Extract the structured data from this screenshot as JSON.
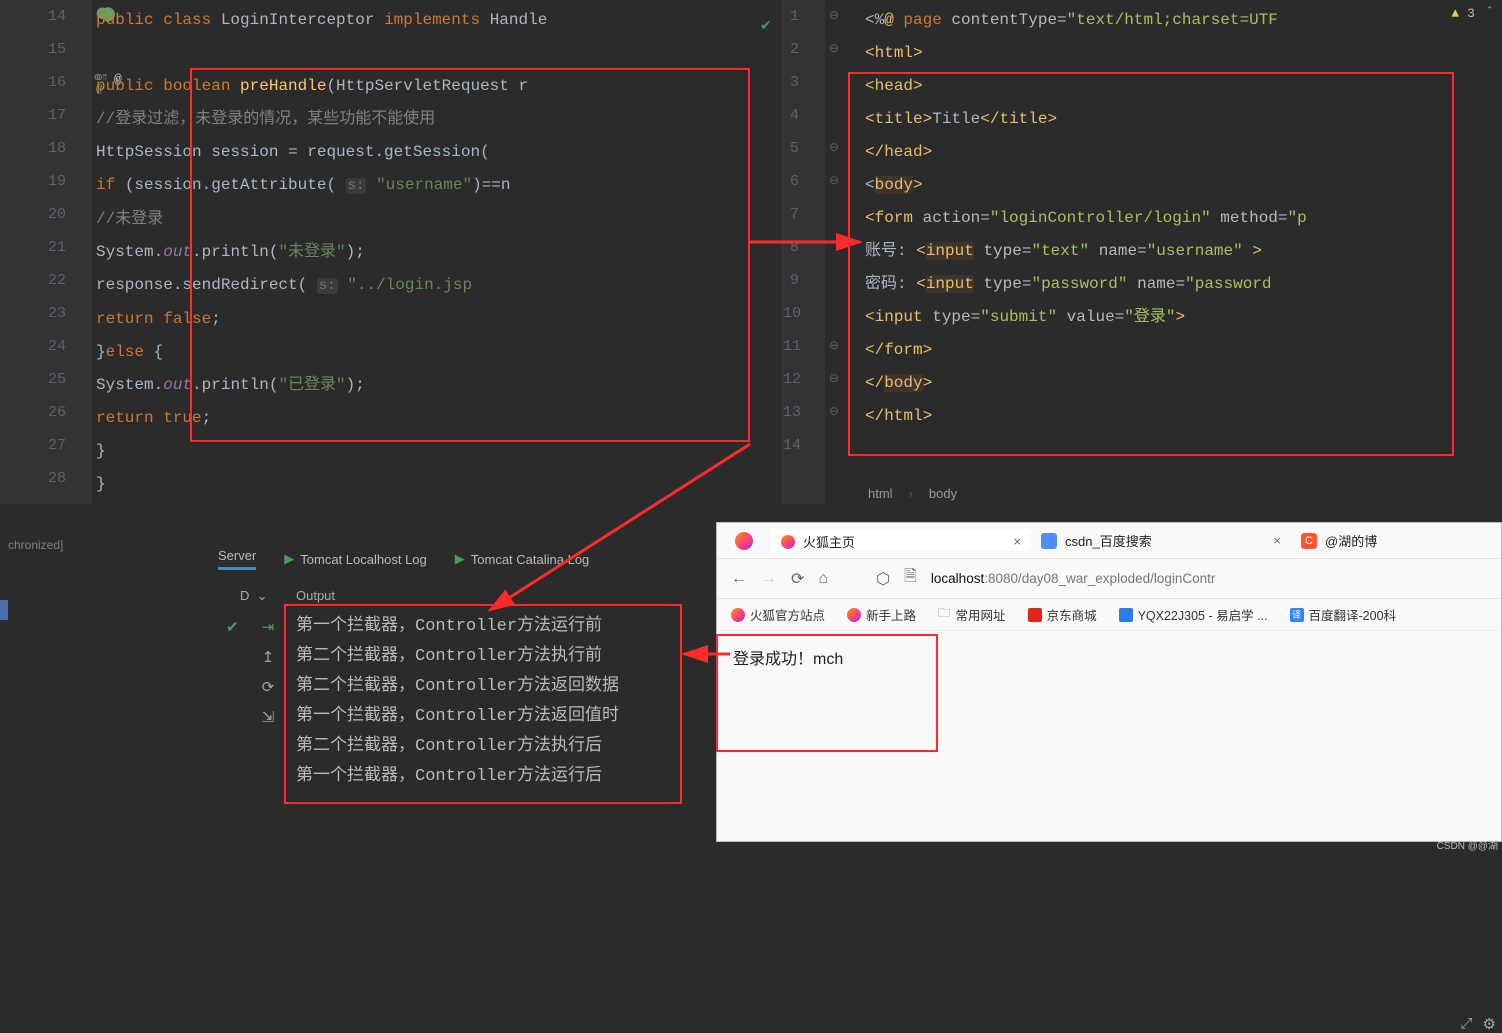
{
  "leftEditor": {
    "startLine": 14,
    "gutterMarks": {
      "14": "⬤",
      "16": "o↑ @"
    },
    "lines": [
      [
        [
          "kw",
          "public "
        ],
        [
          "kw",
          "class "
        ],
        [
          "cls",
          "LoginInterceptor "
        ],
        [
          "kw",
          "implements "
        ],
        [
          "cls",
          "Handle"
        ]
      ],
      [],
      [
        [
          "kw",
          "    public "
        ],
        [
          "kw",
          "boolean "
        ],
        [
          "method",
          "preHandle"
        ],
        [
          "",
          "(HttpServletRequest r"
        ]
      ],
      [
        [
          "cmt",
          "        //登录过滤，未登录的情况，某些功能不能使用"
        ]
      ],
      [
        [
          "",
          "        HttpSession session = request.getSessio"
        ],
        [
          "",
          "n("
        ]
      ],
      [
        [
          "kw",
          "        if "
        ],
        [
          "",
          "(session.getAttribute( "
        ],
        [
          "paramhint",
          "s:"
        ],
        [
          "",
          ""
        ],
        [
          "str",
          " \"username\""
        ],
        [
          "",
          ")==n"
        ]
      ],
      [
        [
          "cmt",
          "            //未登录"
        ]
      ],
      [
        [
          "",
          "            System."
        ],
        [
          "static-it",
          "out"
        ],
        [
          "",
          ".println("
        ],
        [
          "str",
          "\"未登录\""
        ],
        [
          "",
          ");"
        ]
      ],
      [
        [
          "",
          "            response.sendRedirect( "
        ],
        [
          "paramhint",
          "s:"
        ],
        [
          "",
          ""
        ],
        [
          "str",
          " \"../login.jsp"
        ]
      ],
      [
        [
          "kw",
          "            return  false"
        ],
        [
          "",
          ";"
        ]
      ],
      [
        [
          "",
          "        }"
        ],
        [
          "kw",
          "else "
        ],
        [
          "",
          "{"
        ]
      ],
      [
        [
          "",
          "            System."
        ],
        [
          "static-it",
          "out"
        ],
        [
          "",
          ".println("
        ],
        [
          "str",
          "\"已登录\""
        ],
        [
          "",
          ");"
        ]
      ],
      [
        [
          "kw",
          "            return true"
        ],
        [
          "",
          ";"
        ]
      ],
      [
        [
          "",
          "        }"
        ]
      ],
      [
        [
          "",
          "    }"
        ]
      ]
    ]
  },
  "rightEditor": {
    "startLine": 1,
    "warn": {
      "count": "3"
    },
    "lines": [
      [
        [
          "",
          "<%"
        ],
        [
          "tag",
          "@ "
        ],
        [
          "kw",
          "page "
        ],
        [
          "attr",
          "contentType"
        ],
        [
          "",
          "="
        ],
        [
          "attrv",
          "\"text/html;charset=UTF"
        ]
      ],
      [
        [
          "tag",
          "<"
        ],
        [
          "tag",
          "html"
        ],
        [
          "tag",
          ">"
        ]
      ],
      [
        [
          "tag",
          "<"
        ],
        [
          "tag",
          "head"
        ],
        [
          "tag",
          ">"
        ]
      ],
      [
        [
          "tag",
          "    <"
        ],
        [
          "tag",
          "title"
        ],
        [
          "tag",
          ">"
        ],
        [
          "",
          "Title"
        ],
        [
          "tag",
          "</"
        ],
        [
          "tag",
          "title"
        ],
        [
          "tag",
          ">"
        ]
      ],
      [
        [
          "tag",
          "</"
        ],
        [
          "tag",
          "head"
        ],
        [
          "tag",
          ">"
        ]
      ],
      [
        [
          "",
          "<"
        ],
        [
          "tag hl-tag",
          "body"
        ],
        [
          "tag",
          ">"
        ]
      ],
      [
        [
          "tag",
          "    <"
        ],
        [
          "tag",
          "form "
        ],
        [
          "attr",
          "action"
        ],
        [
          "",
          "="
        ],
        [
          "attrv",
          "\"loginController/login\" "
        ],
        [
          "attr",
          "method"
        ],
        [
          "",
          "="
        ],
        [
          "attrv",
          "\"p"
        ]
      ],
      [
        [
          "",
          "        账号: "
        ],
        [
          "tag",
          "<"
        ],
        [
          "tag hl-tag",
          "input"
        ],
        [
          "",
          ""
        ],
        [
          "attr",
          " type"
        ],
        [
          "",
          "="
        ],
        [
          "attrv",
          "\"text\" "
        ],
        [
          "attr",
          "name"
        ],
        [
          "",
          "="
        ],
        [
          "attrv",
          "\"username\" "
        ],
        [
          "tag",
          ">"
        ]
      ],
      [
        [
          "",
          "        密码: "
        ],
        [
          "tag",
          "<"
        ],
        [
          "tag hl-tag",
          "input"
        ],
        [
          "",
          ""
        ],
        [
          "attr",
          " type"
        ],
        [
          "",
          "="
        ],
        [
          "attrv",
          "\"password\" "
        ],
        [
          "attr",
          "name"
        ],
        [
          "",
          "="
        ],
        [
          "attrv",
          "\"password"
        ]
      ],
      [
        [
          "tag",
          "        <"
        ],
        [
          "tag",
          "input "
        ],
        [
          "attr",
          "type"
        ],
        [
          "",
          "="
        ],
        [
          "attrv",
          "\"submit\" "
        ],
        [
          "attr",
          "value"
        ],
        [
          "",
          "="
        ],
        [
          "attrv",
          "\"登录\""
        ],
        [
          "tag",
          ">"
        ]
      ],
      [
        [
          "tag",
          "    </"
        ],
        [
          "tag",
          "form"
        ],
        [
          "tag",
          ">"
        ]
      ],
      [
        [
          "tag",
          "</"
        ],
        [
          "tag hl-tag",
          "body"
        ],
        [
          "tag",
          ">"
        ]
      ],
      [
        [
          "tag",
          "</"
        ],
        [
          "tag",
          "html"
        ],
        [
          "tag",
          ">"
        ]
      ],
      []
    ]
  },
  "breadcrumb": {
    "a": "html",
    "b": "body"
  },
  "tabs": {
    "server": "Server",
    "log1": "Tomcat Localhost Log",
    "log2": "Tomcat Catalina Log"
  },
  "outputHeader": "Output",
  "dHeader": "D",
  "syncText": "chronized]",
  "output": [
    "第一个拦截器，Controller方法运行前",
    "第二个拦截器，Controller方法执行前",
    "第二个拦截器，Controller方法返回数据",
    "第一个拦截器，Controller方法返回值时",
    "第二个拦截器，Controller方法执行后",
    "第一个拦截器，Controller方法运行后"
  ],
  "browser": {
    "tabs": [
      {
        "icon": "ff",
        "title": "火狐主页",
        "close": true
      },
      {
        "icon": "csdn",
        "title": "csdn_百度搜索",
        "close": true
      },
      {
        "icon": "c",
        "title": "@湖的博"
      }
    ],
    "urlHost": "localhost",
    "urlRest": ":8080/day08_war_exploded/loginContr",
    "bookmarks": [
      "火狐官方站点",
      "新手上路",
      "常用网址",
      "京东商城",
      "YQX22J305 - 易启学 ...",
      "百度翻译-200科"
    ],
    "bmIcons": [
      "ff",
      "ff",
      "folder",
      "jd",
      "q",
      "fy"
    ],
    "body": "登录成功！mch"
  },
  "watermark": "CSDN @@湖"
}
